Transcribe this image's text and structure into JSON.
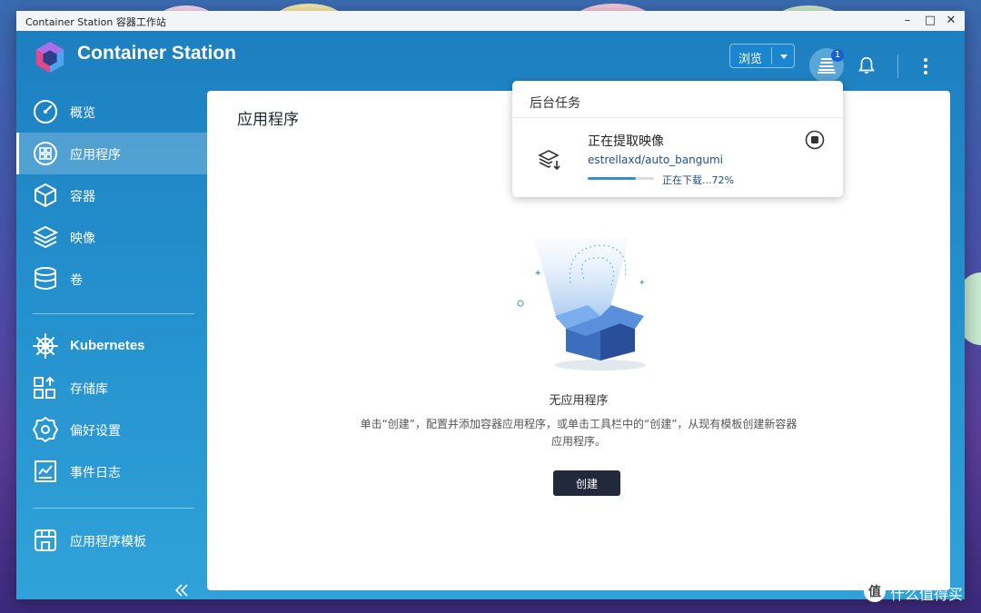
{
  "window": {
    "title": "Container Station 容器工作站"
  },
  "header": {
    "app_title": "Container Station",
    "browse_label": "浏览",
    "task_count": "1"
  },
  "sidebar": {
    "items": [
      {
        "label": "概览",
        "icon": "gauge-icon"
      },
      {
        "label": "应用程序",
        "icon": "apps-grid-icon",
        "active": true
      },
      {
        "label": "容器",
        "icon": "cube-icon"
      },
      {
        "label": "映像",
        "icon": "layers-icon"
      },
      {
        "label": "卷",
        "icon": "database-icon"
      }
    ],
    "k8s": {
      "label": "Kubernetes",
      "icon": "helm-wheel-icon"
    },
    "items2": [
      {
        "label": "存储库",
        "icon": "repository-icon"
      },
      {
        "label": "偏好设置",
        "icon": "settings-gear-icon"
      },
      {
        "label": "事件日志",
        "icon": "log-chart-icon"
      }
    ],
    "templates": {
      "label": "应用程序模板",
      "icon": "store-icon"
    }
  },
  "main": {
    "title": "应用程序",
    "empty_title": "无应用程序",
    "empty_desc": "单击“创建”，配置并添加容器应用程序，或单击工具栏中的“创建”，从现有模板创建新容器应用程序。",
    "create_label": "创建"
  },
  "task_popup": {
    "header": "后台任务",
    "task_title": "正在提取映像",
    "task_name": "estrellaxd/auto_bangumi",
    "progress": 0.72,
    "status": "正在下载...72%"
  },
  "watermark": {
    "text": "什么值得买"
  },
  "colors": {
    "accent": "#1d7fc0",
    "button_dark": "#22293a",
    "progress": "#2f8fd8"
  }
}
